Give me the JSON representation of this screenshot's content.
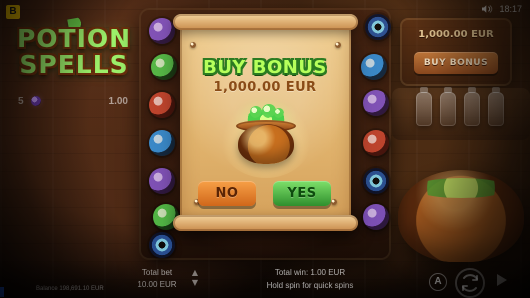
{
  "brand": {
    "badge": "B"
  },
  "status": {
    "time": "18:17"
  },
  "logo": {
    "line1": "POTION",
    "line2": "SPELLS"
  },
  "left_info": {
    "count": "5",
    "multiplier": "1.00"
  },
  "right_panel": {
    "price": "1,000.00 EUR",
    "buy_label": "BUY BONUS"
  },
  "modal": {
    "title": "BUY BONUS",
    "amount": "1,000.00 EUR",
    "no_label": "NO",
    "yes_label": "YES"
  },
  "bottom": {
    "info_icon": "i",
    "settings_icon": "⚙",
    "balance": "Balance 198,691.10 EUR",
    "total_bet_label": "Total bet",
    "total_bet_value": "10.00 EUR",
    "total_win": "Total win: 1.00 EUR",
    "hint": "Hold spin for quick spins",
    "auto_label": "A"
  },
  "icons": {
    "sound": "sound-icon",
    "info": "info-icon",
    "settings": "gear-icon",
    "auto": "autoplay-icon",
    "spin": "spin-icon",
    "play": "play-icon"
  },
  "colors": {
    "title_green": "#b6ff5b",
    "amount_brown": "#8a4c17",
    "yes_green": "#2f8f2d",
    "no_orange": "#d0671a"
  }
}
